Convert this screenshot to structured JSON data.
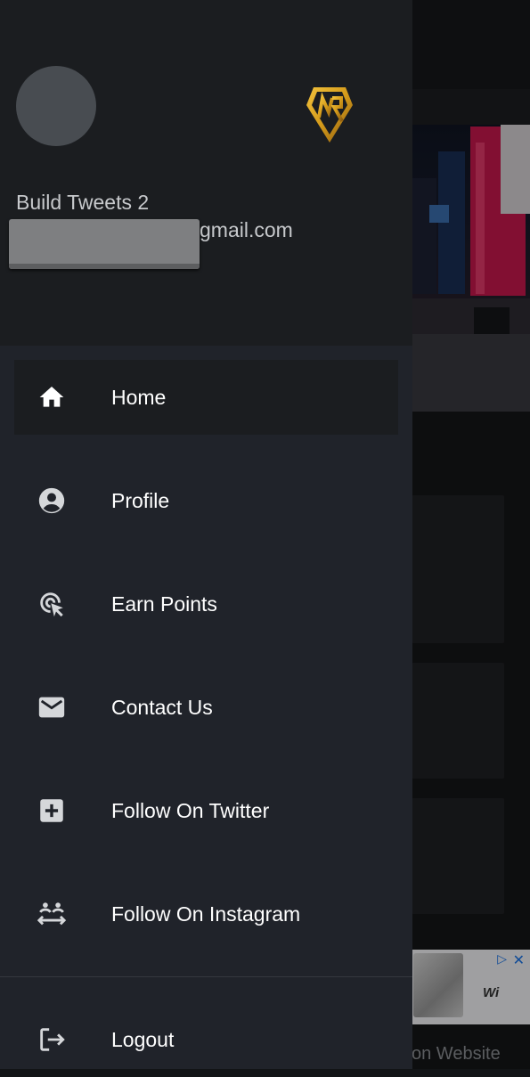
{
  "header": {
    "user_name": "Build Tweets 2",
    "user_email": "gmail.com"
  },
  "menu": {
    "items": [
      {
        "label": "Home",
        "icon": "home-icon",
        "active": true
      },
      {
        "label": "Profile",
        "icon": "account-circle-icon"
      },
      {
        "label": "Earn Points",
        "icon": "ads-click-icon"
      },
      {
        "label": "Contact Us",
        "icon": "mail-icon"
      },
      {
        "label": "Follow On Twitter",
        "icon": "add-box-icon"
      },
      {
        "label": "Follow On Instagram",
        "icon": "group-follow-icon"
      }
    ],
    "logout_label": "Logout"
  },
  "background": {
    "ad_brand": "Wi",
    "ad_subtext": "on Website"
  },
  "colors": {
    "drawer_bg": "#20232a",
    "header_bg": "#1b1d20",
    "active_item_bg": "#1b1d20",
    "text": "#ffffff",
    "icon": "#d5d7da",
    "logo_gold": "#d49a1a"
  }
}
